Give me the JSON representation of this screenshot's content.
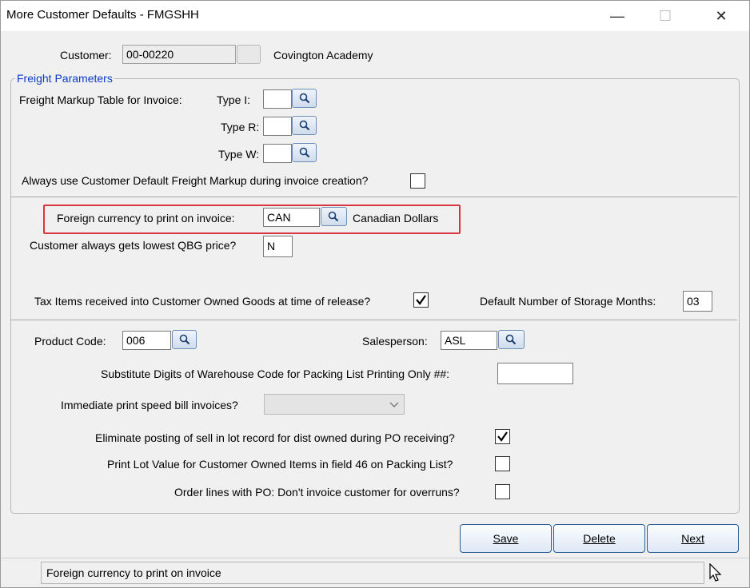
{
  "window": {
    "title": "More Customer Defaults - FMGSHH",
    "minimize": "—",
    "maximize": "☐",
    "close": "✕"
  },
  "customer": {
    "label": "Customer:",
    "code": "00-00220",
    "name": "Covington Academy"
  },
  "freight": {
    "group_title": "Freight Parameters",
    "markup_label": "Freight Markup Table for Invoice:",
    "type_i_label": "Type I:",
    "type_r_label": "Type R:",
    "type_w_label": "Type W:",
    "type_i_value": "",
    "type_r_value": "",
    "type_w_value": "",
    "always_default_label": "Always use Customer Default Freight Markup during invoice creation?",
    "always_default_checked": false
  },
  "currency": {
    "label": "Foreign currency to print on invoice:",
    "value": "CAN",
    "description": "Canadian Dollars",
    "highlight_color": "#d9343f"
  },
  "qbg": {
    "label": "Customer always gets lowest QBG price?",
    "value": "N"
  },
  "tax": {
    "label": "Tax Items received into Customer Owned Goods at time of release?",
    "checked": true
  },
  "storage": {
    "label": "Default Number of Storage Months:",
    "value": "03"
  },
  "product": {
    "label": "Product Code:",
    "value": "006"
  },
  "salesperson": {
    "label": "Salesperson:",
    "value": "ASL"
  },
  "warehouse": {
    "label": "Substitute Digits of Warehouse Code for Packing List Printing Only ##:",
    "value": ""
  },
  "speedbill": {
    "label": "Immediate print speed bill invoices?",
    "value": ""
  },
  "eliminate": {
    "label": "Eliminate posting of sell in lot record for dist owned during PO receiving?",
    "checked": true
  },
  "lotvalue": {
    "label": "Print Lot Value for Customer Owned Items in field 46 on Packing List?",
    "checked": false
  },
  "overruns": {
    "label": "Order lines with PO: Don't invoice customer for overruns?",
    "checked": false
  },
  "buttons": {
    "save": "Save",
    "delete": "Delete",
    "next": "Next"
  },
  "status": {
    "text": "Foreign currency to print on invoice"
  },
  "icons": {
    "lookup": "magnifier-icon",
    "check": "checkmark-icon",
    "dropdown": "chevron-down-icon",
    "cursor": "mouse-cursor-icon"
  }
}
